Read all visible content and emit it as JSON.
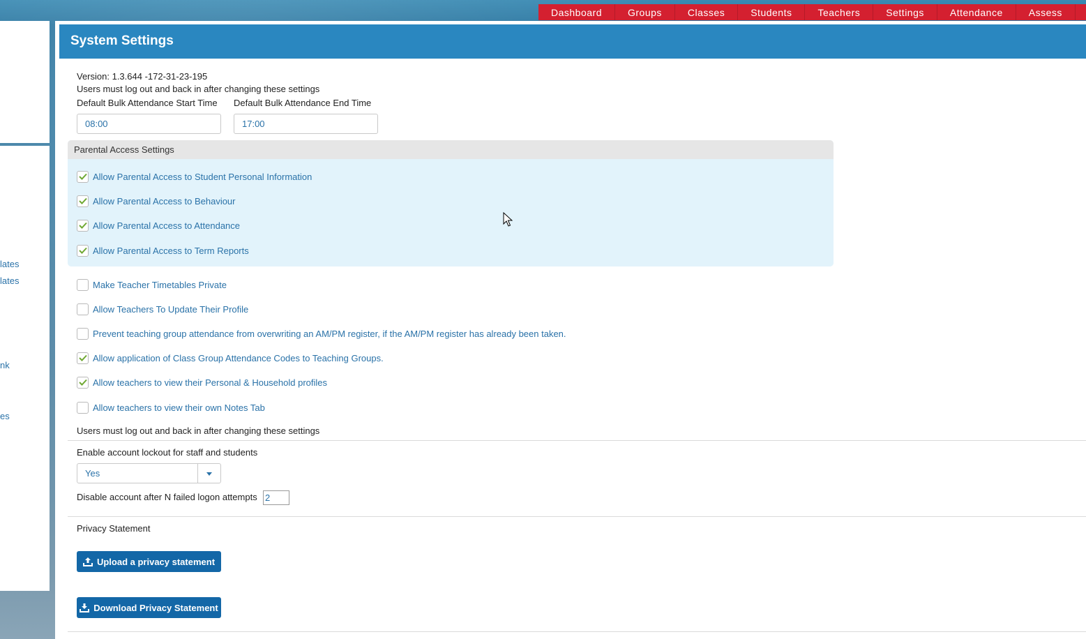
{
  "nav": {
    "tabs": [
      "Dashboard",
      "Groups",
      "Classes",
      "Students",
      "Teachers",
      "Settings",
      "Attendance",
      "Assess"
    ]
  },
  "sidebar": {
    "links": [
      "lates",
      "lates",
      "nk",
      "es"
    ]
  },
  "page": {
    "title": "System Settings",
    "version": "Version: 1.3.644 -172-31-23-195",
    "logout_note": "Users must log out and back in after changing these settings",
    "start_time_label": "Default Bulk Attendance Start Time",
    "start_time_value": "08:00",
    "end_time_label": "Default Bulk Attendance End Time",
    "end_time_value": "17:00"
  },
  "parental": {
    "heading": "Parental Access Settings",
    "options": [
      {
        "label": "Allow Parental Access to Student Personal Information",
        "checked": true
      },
      {
        "label": "Allow Parental Access to Behaviour",
        "checked": true
      },
      {
        "label": "Allow Parental Access to Attendance",
        "checked": true
      },
      {
        "label": "Allow Parental Access to Term Reports",
        "checked": true
      }
    ]
  },
  "teacher_options": [
    {
      "label": "Make Teacher Timetables Private",
      "checked": false
    },
    {
      "label": "Allow Teachers To Update Their Profile",
      "checked": false
    },
    {
      "label": "Prevent teaching group attendance from overwriting an AM/PM register, if the AM/PM register has already been taken.",
      "checked": false
    },
    {
      "label": "Allow application of Class Group Attendance Codes to Teaching Groups.",
      "checked": true
    },
    {
      "label": "Allow teachers to view their Personal & Household profiles",
      "checked": true
    },
    {
      "label": "Allow teachers to view their own Notes Tab",
      "checked": false
    }
  ],
  "lockout": {
    "logout_note": "Users must log out and back in after changing these settings",
    "enable_label": "Enable account lockout for staff and students",
    "enable_value": "Yes",
    "attempts_label": "Disable account after N failed logon attempts",
    "attempts_value": "2"
  },
  "privacy": {
    "heading": "Privacy Statement",
    "upload_label": "Upload a privacy statement",
    "download_label": "Download Privacy Statement"
  },
  "colors": {
    "nav_bg": "#d42030",
    "header_bg": "#2a87c0",
    "button_bg": "#1367a7",
    "check": "#6fa832",
    "link": "#2a72a8"
  }
}
